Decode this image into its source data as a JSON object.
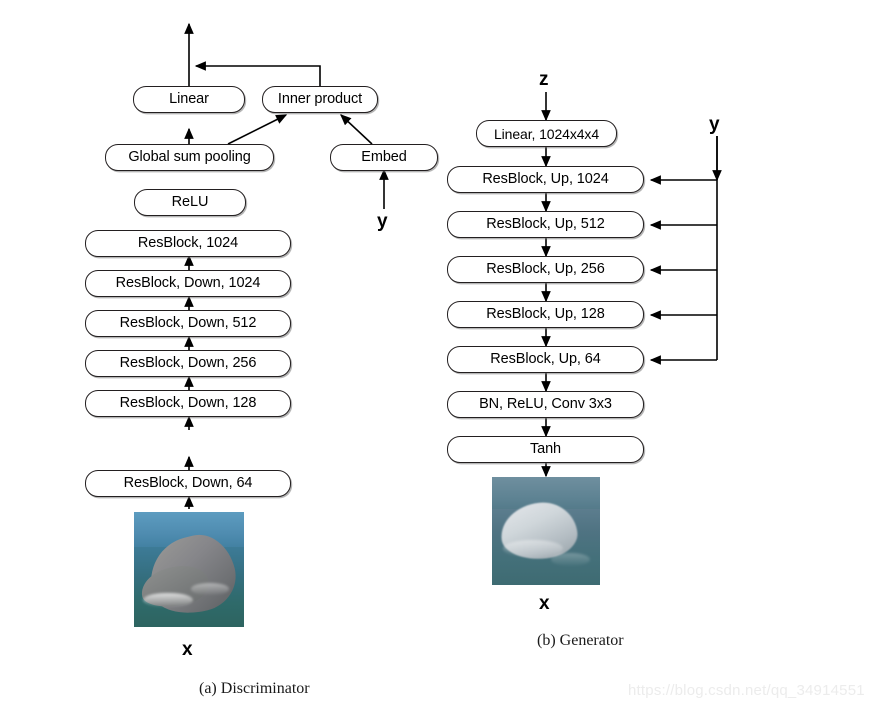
{
  "figure": {
    "panels": [
      {
        "id": "discriminator",
        "caption": "(a) Discriminator",
        "input_label": "x",
        "condition_label": "y",
        "nodes": [
          {
            "name": "linear",
            "label": "Linear"
          },
          {
            "name": "inner-product",
            "label": "Inner product"
          },
          {
            "name": "global-sum-pooling",
            "label": "Global sum pooling"
          },
          {
            "name": "embed",
            "label": "Embed"
          },
          {
            "name": "relu",
            "label": "ReLU"
          },
          {
            "name": "resblock-1024",
            "label": "ResBlock, 1024"
          },
          {
            "name": "resblock-down-1024",
            "label": "ResBlock, Down, 1024"
          },
          {
            "name": "resblock-down-512",
            "label": "ResBlock, Down, 512"
          },
          {
            "name": "resblock-down-256",
            "label": "ResBlock, Down, 256"
          },
          {
            "name": "resblock-down-128",
            "label": "ResBlock, Down, 128"
          },
          {
            "name": "resblock-down-64",
            "label": "ResBlock, Down, 64"
          }
        ]
      },
      {
        "id": "generator",
        "caption": "(b) Generator",
        "input_label": "z",
        "condition_label": "y",
        "output_label": "x",
        "nodes": [
          {
            "name": "linear-1024x4x4",
            "label": "Linear, 1024x4x4"
          },
          {
            "name": "resblock-up-1024",
            "label": "ResBlock, Up, 1024"
          },
          {
            "name": "resblock-up-512",
            "label": "ResBlock, Up, 512"
          },
          {
            "name": "resblock-up-256",
            "label": "ResBlock, Up, 256"
          },
          {
            "name": "resblock-up-128",
            "label": "ResBlock, Up, 128"
          },
          {
            "name": "resblock-up-64",
            "label": "ResBlock, Up, 64"
          },
          {
            "name": "bn-relu-conv",
            "label": "BN, ReLU, Conv 3x3"
          },
          {
            "name": "tanh",
            "label": "Tanh"
          }
        ]
      }
    ],
    "watermark": "https://blog.csdn.net/qq_34914551",
    "colors": {
      "box_border": "#231f20",
      "box_fill": "#ffffff",
      "arrow": "#000000",
      "watermark": "#ececec"
    }
  }
}
